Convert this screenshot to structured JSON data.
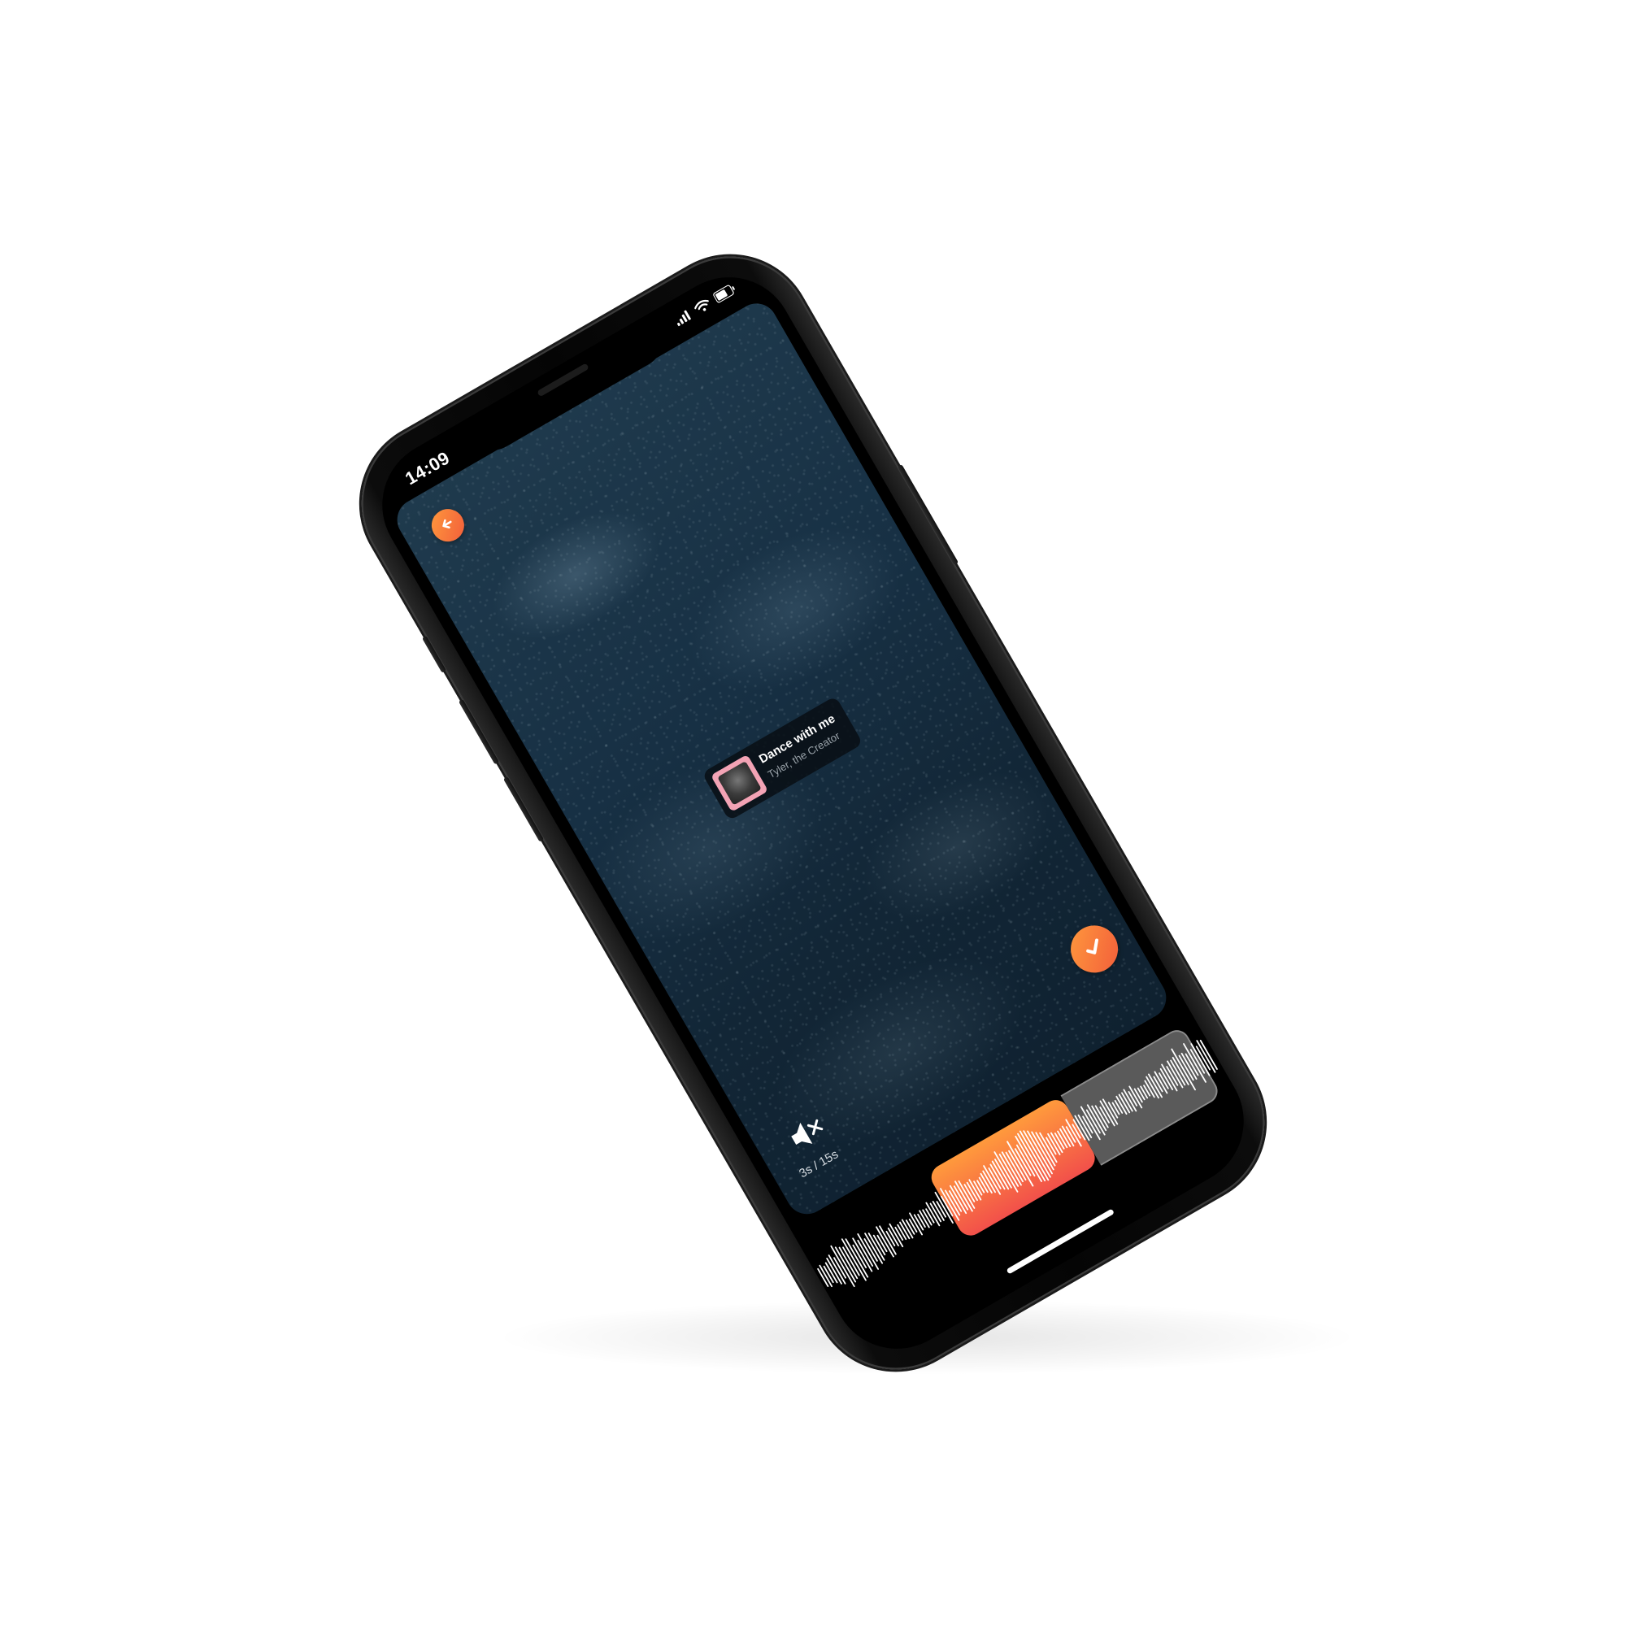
{
  "status_bar": {
    "time": "14:09",
    "signal_icon": "cellular-signal-icon",
    "wifi_icon": "wifi-icon",
    "battery_icon": "battery-icon"
  },
  "song": {
    "title": "Dance with me",
    "artist": "Tyler, the Creator",
    "album_art_icon": "album-art"
  },
  "controls": {
    "back_icon": "arrow-left-icon",
    "confirm_icon": "checkmark-icon",
    "mute_icon": "speaker-muted-icon"
  },
  "duration_label": "3s / 15s",
  "trim": {
    "selected_seconds": 3,
    "max_seconds": 15
  },
  "colors": {
    "accent_start": "#ff9a3c",
    "accent_end": "#f25c3b",
    "inactive_selection": "#5a5a5a",
    "background": "#173044"
  }
}
